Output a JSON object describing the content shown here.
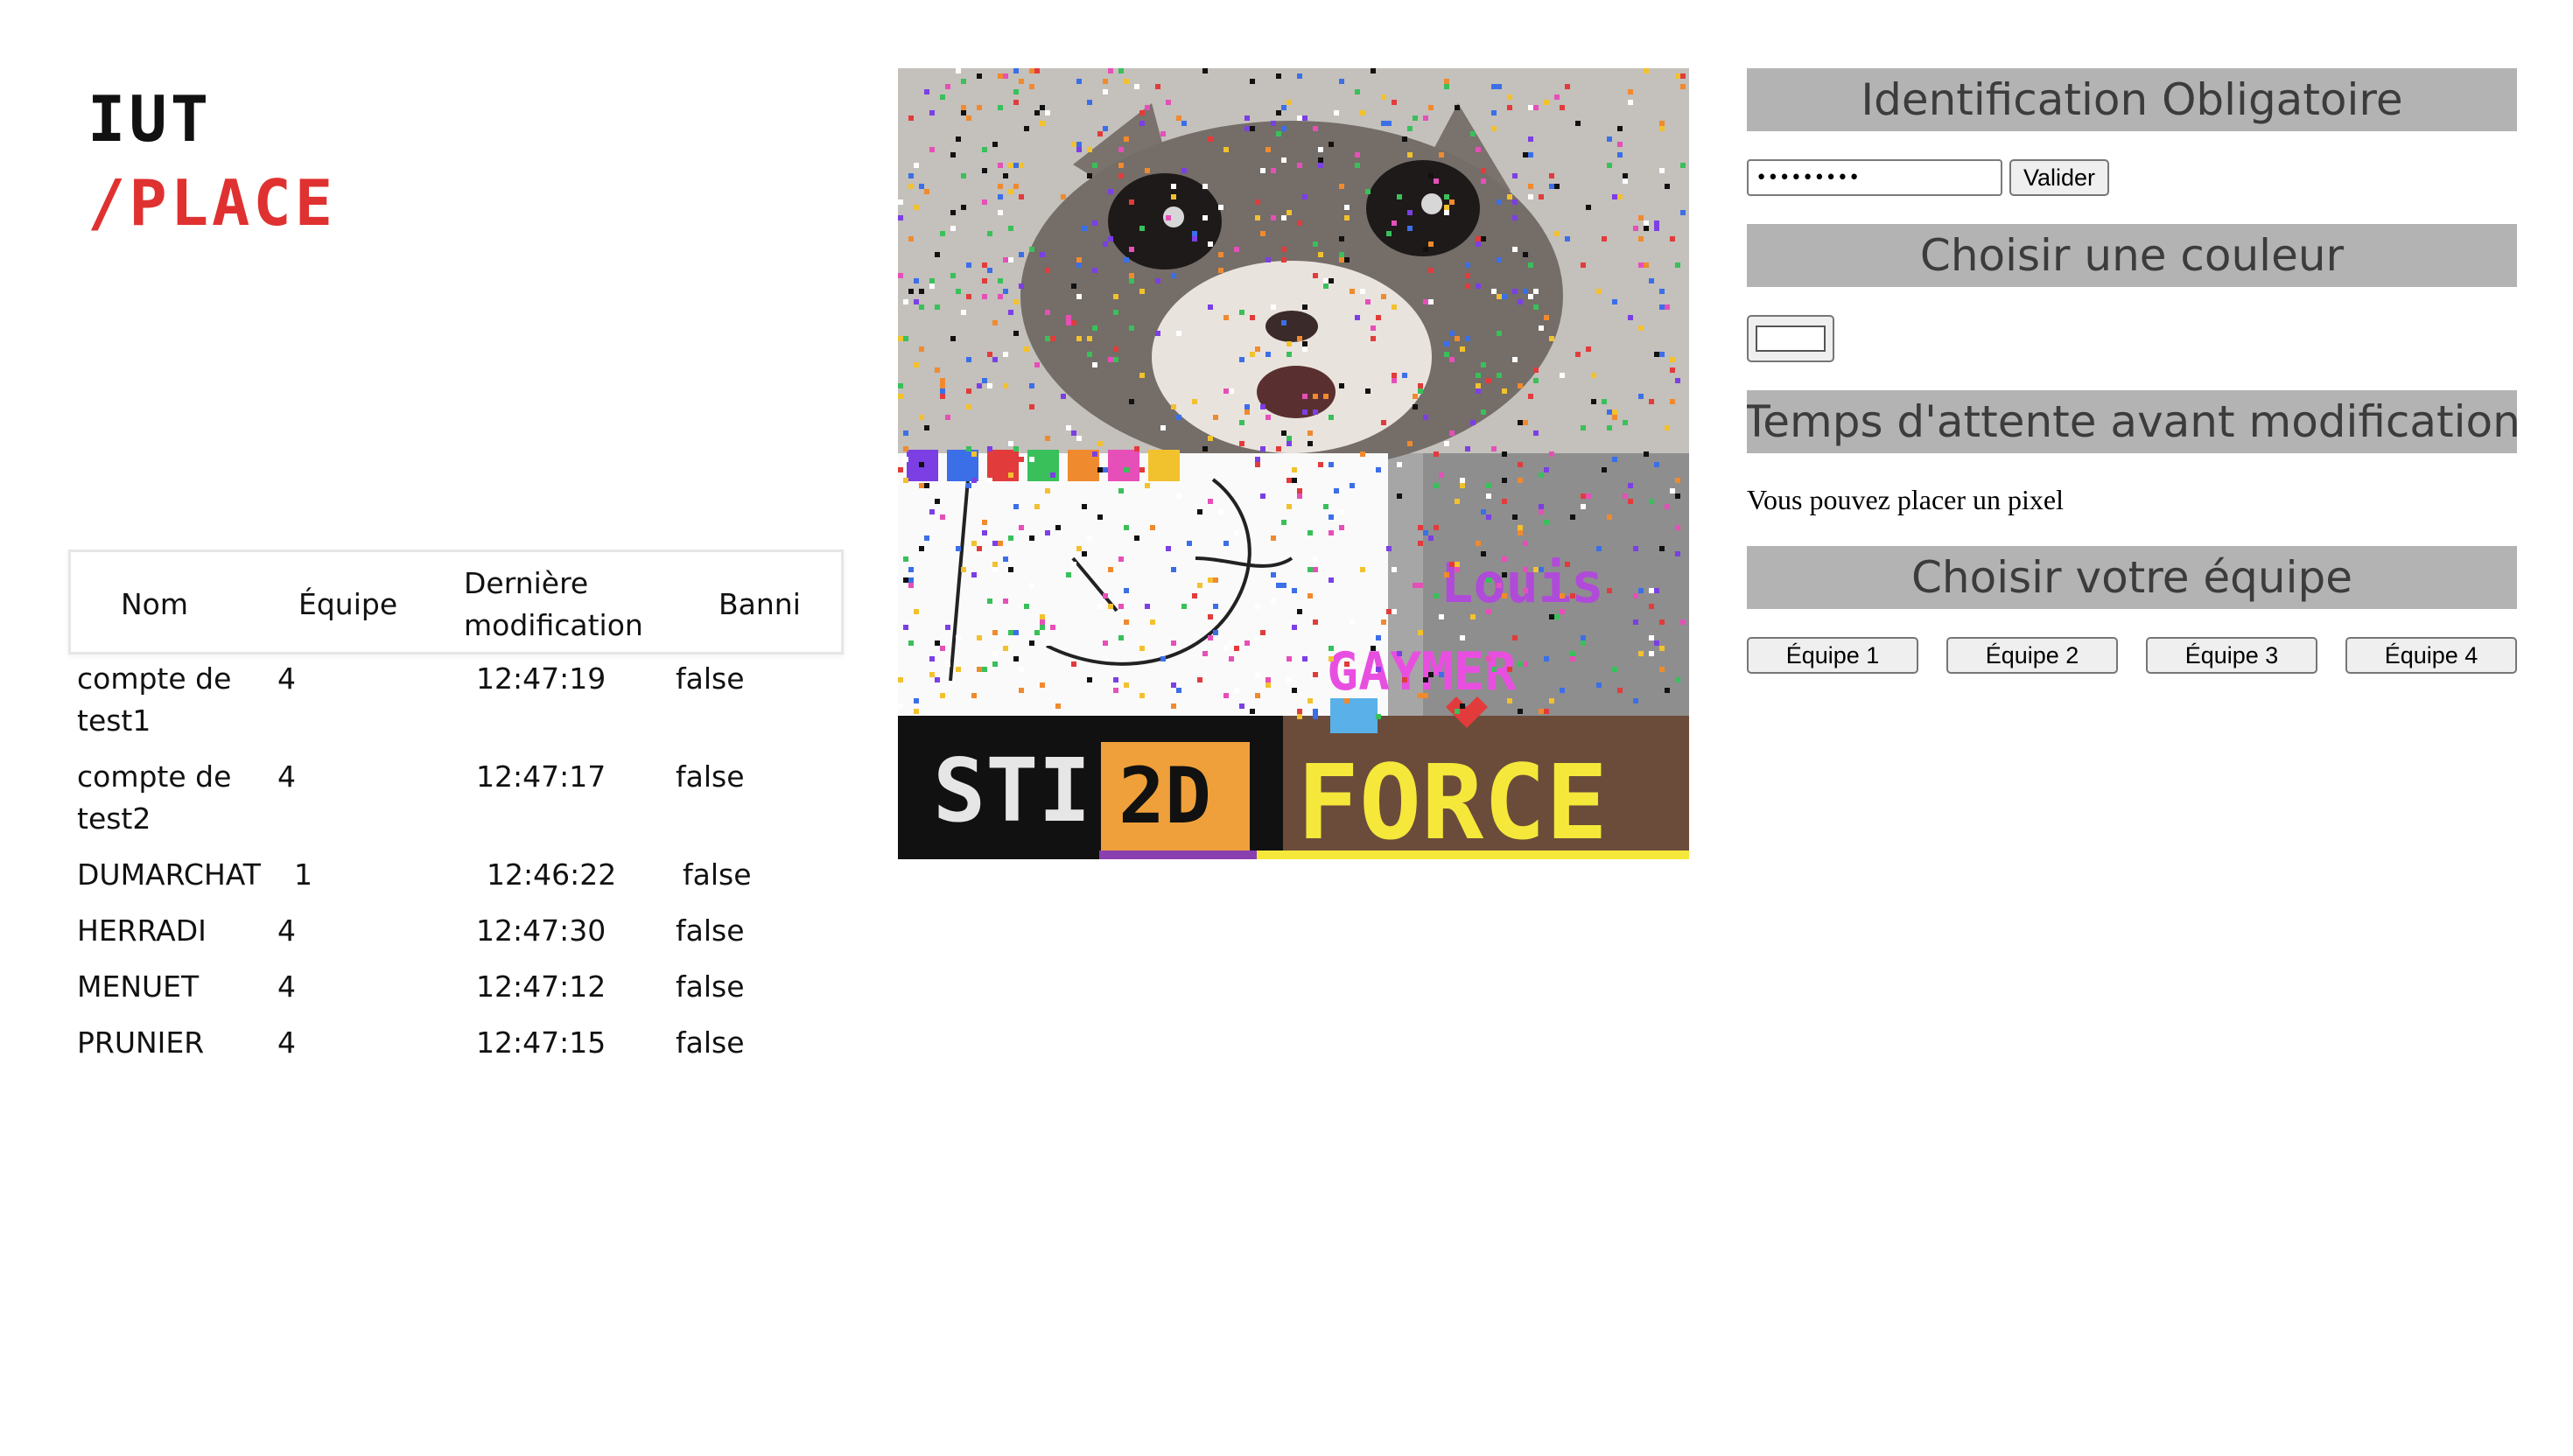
{
  "logo": {
    "line1": "IUT",
    "line2": "/PLACE"
  },
  "table": {
    "headers": {
      "nom": "Nom",
      "equipe": "Équipe",
      "derniere_modification": "Dernière modification",
      "banni": "Banni"
    },
    "rows": [
      {
        "nom": "compte de test1",
        "equipe": "4",
        "derniere_modification": "12:47:19",
        "banni": "false"
      },
      {
        "nom": "compte de test2",
        "equipe": "4",
        "derniere_modification": "12:47:17",
        "banni": "false"
      },
      {
        "nom": "DUMARCHAT",
        "equipe": "1",
        "derniere_modification": "12:46:22",
        "banni": "false"
      },
      {
        "nom": "HERRADI",
        "equipe": "4",
        "derniere_modification": "12:47:30",
        "banni": "false"
      },
      {
        "nom": "MENUET",
        "equipe": "4",
        "derniere_modification": "12:47:12",
        "banni": "false"
      },
      {
        "nom": "PRUNIER",
        "equipe": "4",
        "derniere_modification": "12:47:15",
        "banni": "false"
      }
    ]
  },
  "canvas": {
    "texts": {
      "louis": "Louis",
      "gaymer": "GAYMER",
      "sti": "STI",
      "badge": "2D",
      "force": "FORCE"
    },
    "colors": {
      "background": "#9a9a9a",
      "cat": "#6f6a66",
      "banner": "#111111",
      "badge": "#f0a03a",
      "gaymer": "#e84fe0",
      "louis": "#b04ad8"
    }
  },
  "panel": {
    "identification": {
      "title": "Identification Obligatoire",
      "password_value": "•••••••••",
      "submit_label": "Valider"
    },
    "color": {
      "title": "Choisir une couleur",
      "selected": "#ffffff"
    },
    "wait": {
      "title": "Temps d'attente avant modification",
      "status": "Vous pouvez placer un pixel"
    },
    "team": {
      "title": "Choisir votre équipe",
      "buttons": [
        "Équipe 1",
        "Équipe 2",
        "Équipe 3",
        "Équipe 4"
      ]
    }
  }
}
